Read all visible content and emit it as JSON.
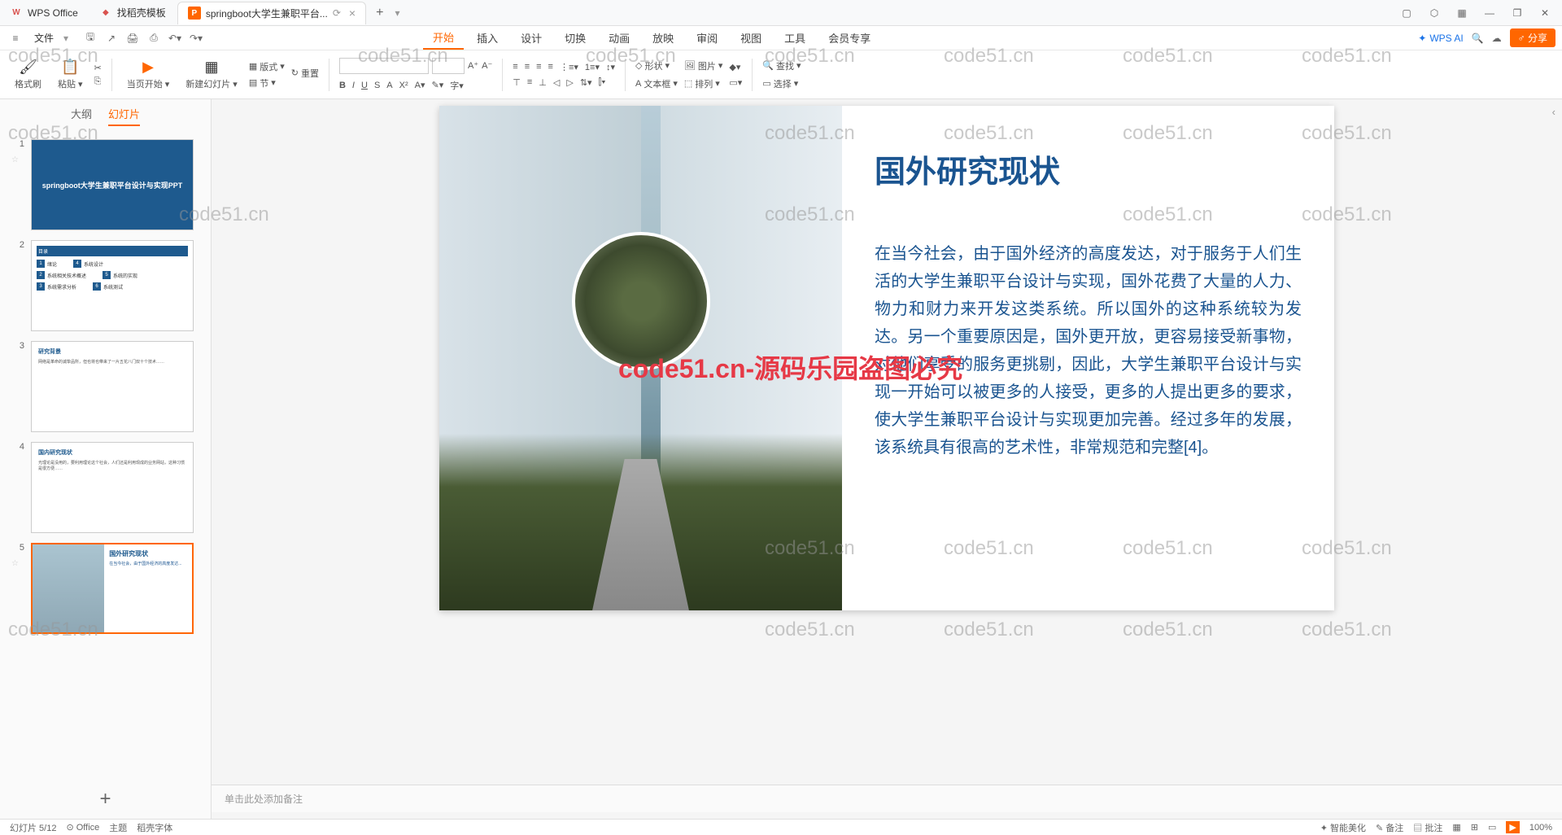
{
  "titlebar": {
    "tabs": [
      {
        "icon": "W",
        "iconColor": "#d9534f",
        "label": "WPS Office"
      },
      {
        "icon": "◆",
        "iconColor": "#d9534f",
        "label": "找稻壳模板"
      },
      {
        "icon": "P",
        "iconColor": "#ff6600",
        "label": "springboot大学生兼职平台...",
        "active": true
      }
    ],
    "newTab": "+",
    "winButtons": [
      "▢",
      "⬡",
      "▦",
      "—",
      "❐",
      "✕"
    ]
  },
  "menubar": {
    "hamburger": "≡",
    "file": "文件",
    "quickIcons": [
      "🖫",
      "↶",
      "🖨",
      "⎘",
      "↷",
      "↻"
    ],
    "tabs": [
      "开始",
      "插入",
      "设计",
      "切换",
      "动画",
      "放映",
      "审阅",
      "视图",
      "工具",
      "会员专享"
    ],
    "activeTab": "开始",
    "wpsAi": "WPS AI",
    "cloud": "☁",
    "share": "分享"
  },
  "ribbon": {
    "clipboard": {
      "brush": "格式刷",
      "paste": "粘贴"
    },
    "slide": {
      "fromCurrent": "当页开始",
      "newSlide": "新建幻灯片",
      "layout": "版式",
      "section": "节",
      "reset": "重置"
    },
    "font": {
      "size": "",
      "bold": "B",
      "italic": "I",
      "underline": "U",
      "strike": "S"
    },
    "shape": {
      "shape": "形状",
      "picture": "图片",
      "textbox": "文本框",
      "arrange": "排列"
    },
    "find": {
      "find": "查找",
      "select": "选择"
    }
  },
  "sidebar": {
    "tabs": {
      "outline": "大纲",
      "slides": "幻灯片"
    },
    "thumbs": [
      {
        "num": "1",
        "title": "springboot大学生兼职平台设计与实现PPT"
      },
      {
        "num": "2",
        "toc": {
          "header": "目录",
          "items": [
            {
              "n": "1",
              "t": "绪论"
            },
            {
              "n": "4",
              "t": "系统设计"
            },
            {
              "n": "2",
              "t": "系统相关技术概述"
            },
            {
              "n": "5",
              "t": "系统的实现"
            },
            {
              "n": "3",
              "t": "系统需求分析"
            },
            {
              "n": "6",
              "t": "系统测试"
            }
          ]
        }
      },
      {
        "num": "3",
        "header": "研究背景",
        "body": "网络是革命的诚挚品所，但也将也带来了一片五花八门双十个技术……"
      },
      {
        "num": "4",
        "header": "国内研究现状",
        "body": "光理论是没用的，要利用理论这个社会，人们还是利用现成的业务网站，这种习惯是很方便……"
      },
      {
        "num": "5",
        "header": "国外研究现状",
        "selected": true
      }
    ]
  },
  "slide": {
    "title": "国外研究现状",
    "body": "在当今社会，由于国外经济的高度发达，对于服务于人们生活的大学生兼职平台设计与实现，国外花费了大量的人力、物力和财力来开发这类系统。所以国外的这种系统较为发达。另一个重要原因是，国外更开放，更容易接受新事物，对他们享受的服务更挑剔，因此，大学生兼职平台设计与实现一开始可以被更多的人接受，更多的人提出更多的要求，使大学生兼职平台设计与实现更加完善。经过多年的发展，该系统具有很高的艺术性，非常规范和完整[4]。"
  },
  "watermarks": {
    "text": "code51.cn",
    "redText": "code51.cn-源码乐园盗图必究"
  },
  "notes": {
    "placeholder": "单击此处添加备注"
  },
  "statusbar": {
    "slidePos": "幻灯片 5/12",
    "office": "Office",
    "theme": "主题",
    "font": "稻壳字体",
    "smart": "智能美化",
    "notes": "备注",
    "comments": "批注",
    "zoom": "100%"
  }
}
